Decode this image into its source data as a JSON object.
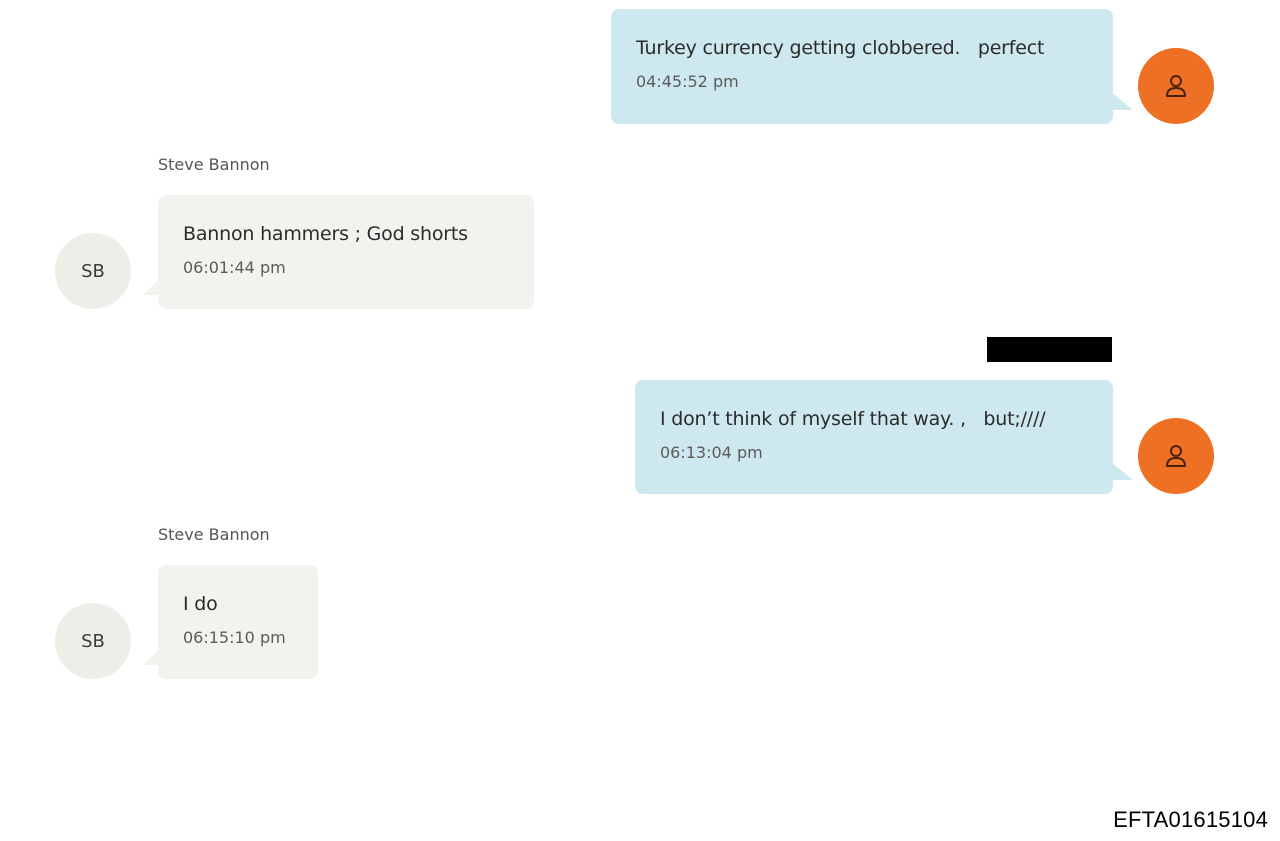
{
  "conversation": {
    "messages": [
      {
        "direction": "outgoing",
        "text": "Turkey currency getting clobbered.   perfect",
        "time": "04:45:52 pm",
        "avatar_icon": "user-icon"
      },
      {
        "direction": "incoming",
        "sender": "Steve Bannon",
        "avatar_initials": "SB",
        "text": "Bannon hammers ; God shorts",
        "time": "06:01:44 pm"
      },
      {
        "direction": "outgoing",
        "text": "I don’t think of myself that way. ,   but;////",
        "time": "06:13:04 pm",
        "avatar_icon": "user-icon",
        "redacted_label": true
      },
      {
        "direction": "incoming",
        "sender": "Steve Bannon",
        "avatar_initials": "SB",
        "text": "I do",
        "time": "06:15:10 pm"
      }
    ]
  },
  "footer": {
    "document_id": "EFTA01615104"
  },
  "colors": {
    "outgoing_bubble": "#cde8ef",
    "incoming_bubble": "#f3f2ee",
    "user_avatar": "#ee7024",
    "contact_avatar": "#eeeee8",
    "redaction": "#000000"
  }
}
